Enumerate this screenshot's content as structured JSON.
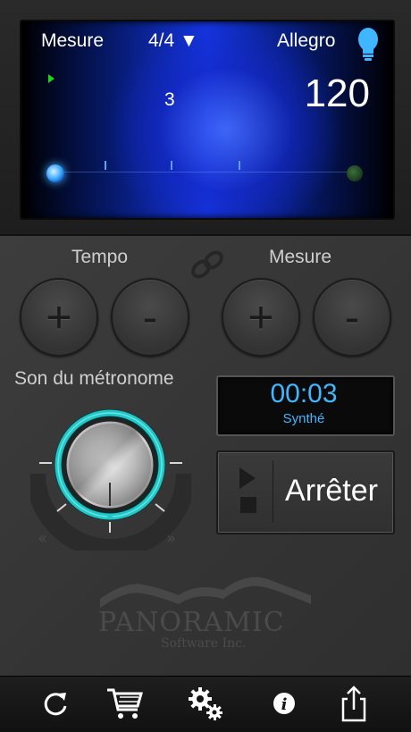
{
  "display": {
    "measure_label": "Mesure",
    "time_signature": "4/4 ▼",
    "tempo_name": "Allegro",
    "beat": "3",
    "bpm": "120"
  },
  "controls": {
    "tempo_label": "Tempo",
    "measure_label": "Mesure",
    "plus": "+",
    "minus": "-",
    "sound_label": "Son du métronome"
  },
  "timer": {
    "time": "00:03",
    "sound_name": "Synthé"
  },
  "transport": {
    "stop_label": "Arrêter"
  },
  "logo": {
    "name": "PANORAMIC",
    "sub": "Software Inc."
  },
  "toolbar": {
    "icons": [
      "refresh-icon",
      "cart-icon",
      "gears-icon",
      "info-icon",
      "share-icon"
    ]
  },
  "colors": {
    "accent_blue": "#3fb6ff",
    "screen_blue": "#1535e0",
    "knob_ring": "#1ec8c8",
    "play_green": "#1dd41d"
  }
}
